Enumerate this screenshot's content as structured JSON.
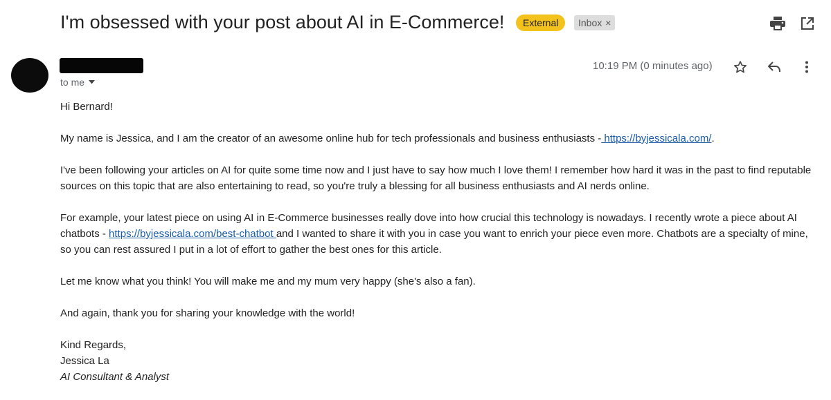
{
  "header": {
    "subject": "I'm obsessed with your post about AI in E-Commerce!",
    "badge_external": "External",
    "badge_inbox": "Inbox",
    "badge_inbox_close": "×",
    "print_icon": "print-icon",
    "popout_icon": "open-in-new-window-icon"
  },
  "message": {
    "to_label": "to me",
    "timestamp": "10:19 PM (0 minutes ago)",
    "greeting": "Hi Bernard!",
    "p1_before": "My name is Jessica, and I am the creator of an awesome online hub for tech professionals and business enthusiasts -",
    "p1_link": " https://byjessicala.com/",
    "p1_after": ".",
    "p2": "I've been following your articles on AI for quite some time now and I just have to say how much I love them! I remember how hard it was in the past to find reputable sources on this topic that are also entertaining to read, so you're truly a blessing for all business enthusiasts and AI nerds online.",
    "p3_before": "For example, your latest piece on using AI in E-Commerce businesses really dove into how crucial this technology is nowadays. I recently wrote a piece about AI chatbots - ",
    "p3_link": "https://byjessicala.com/best-chatbot ",
    "p3_after": " and I wanted to share it with you in case you want to enrich your piece even more. Chatbots are a specialty of mine, so you can rest assured I put in a lot of effort to gather the best ones for this article.",
    "p4": "Let me know what you think! You will make me and my mum very happy (she's also a fan).",
    "p5": "And again, thank you for sharing your knowledge with the world!",
    "sig_regards": "Kind Regards,",
    "sig_name": "Jessica La",
    "sig_title": "AI Consultant & Analyst"
  },
  "icons": {
    "star": "star-icon",
    "reply": "reply-icon",
    "more": "more-vertical-icon",
    "caret": "caret-down-icon"
  }
}
